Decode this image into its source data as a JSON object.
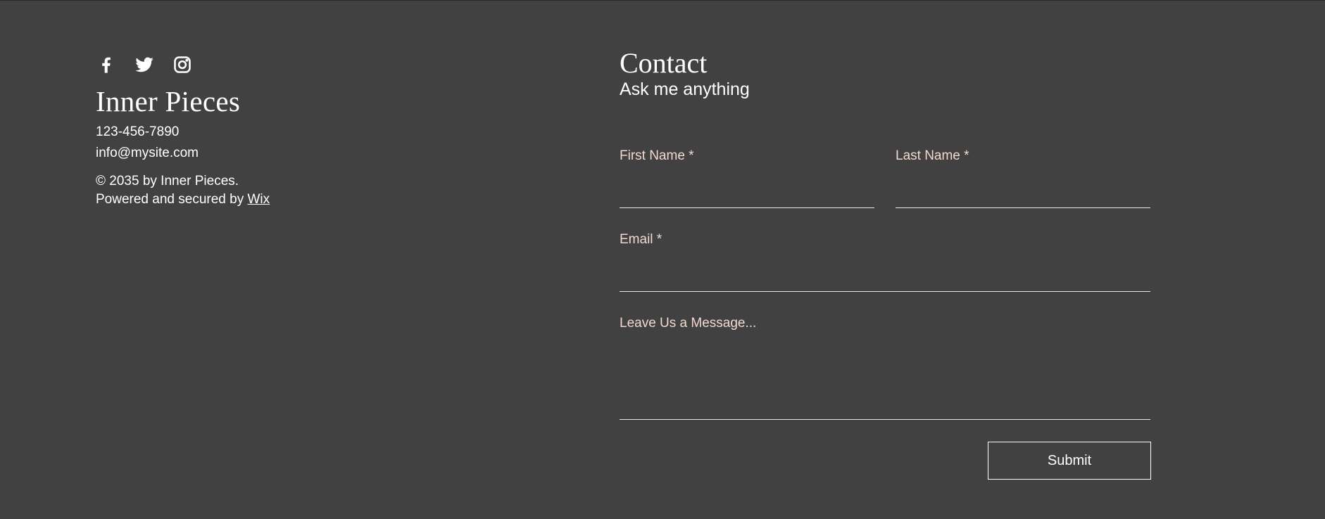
{
  "social": {
    "facebook_icon": "facebook-icon",
    "twitter_icon": "twitter-icon",
    "instagram_icon": "instagram-icon"
  },
  "footer": {
    "brand": "Inner Pieces",
    "phone": "123-456-7890",
    "email": "info@mysite.com",
    "copyright": "© 2035 by Inner Pieces.",
    "powered_prefix": "Powered and secured by ",
    "powered_link": "Wix"
  },
  "contact": {
    "title": "Contact",
    "subtitle": "Ask me anything",
    "first_name_label": "First Name *",
    "first_name_value": "",
    "last_name_label": "Last Name *",
    "last_name_value": "",
    "email_label": "Email *",
    "email_value": "",
    "message_label": "Leave Us a Message...",
    "message_value": "",
    "submit_label": "Submit"
  },
  "colors": {
    "background": "#414141",
    "text": "#ffffff",
    "label": "#f3d9cf"
  }
}
